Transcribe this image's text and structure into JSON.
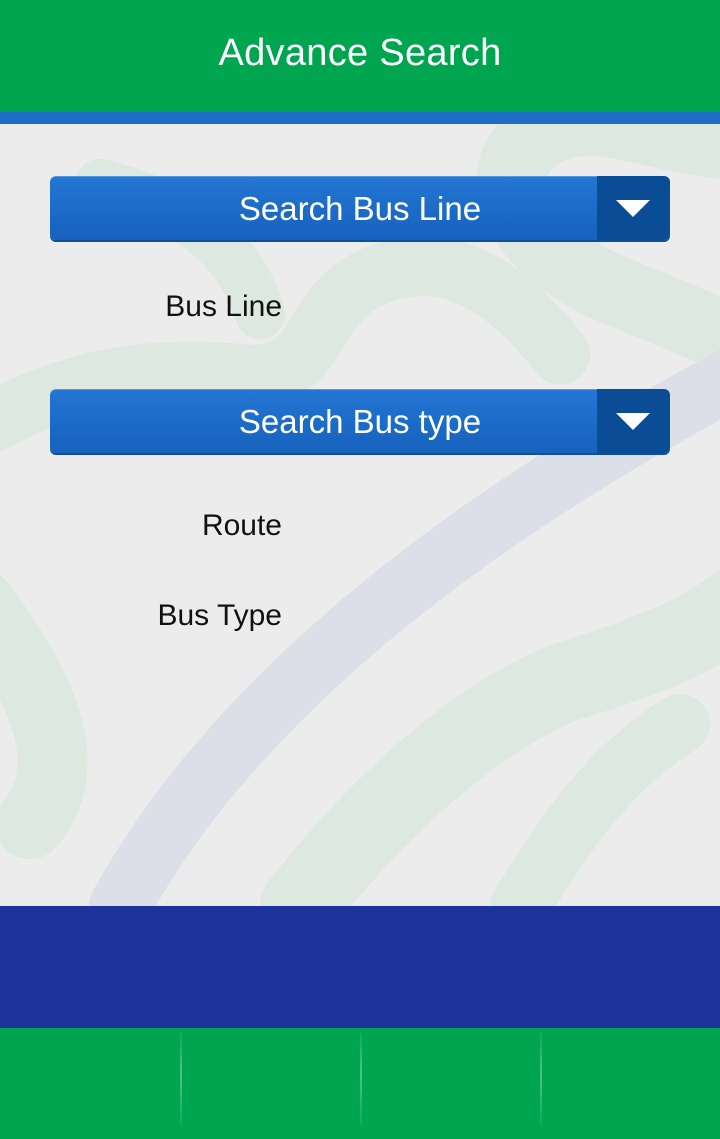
{
  "header": {
    "title": "Advance Search"
  },
  "search": {
    "bus_line_dropdown": {
      "label": "Search Bus Line",
      "icon": "triangle-down-icon"
    },
    "bus_type_dropdown": {
      "label": "Search Bus type",
      "icon": "triangle-down-icon"
    }
  },
  "results": {
    "bus_line_label": "Bus Line",
    "route_label": "Route",
    "bus_type_label": "Bus Type"
  },
  "footer": {
    "tabs": [
      "",
      "",
      "",
      ""
    ]
  },
  "colors": {
    "header_green": "#00a54f",
    "accent_blue": "#1c6dc6",
    "dropdown_blue": "#1b6bc7",
    "dropdown_arrow_bg": "#0b4c97",
    "footer_navy": "#1b339a",
    "background": "#ececec"
  }
}
